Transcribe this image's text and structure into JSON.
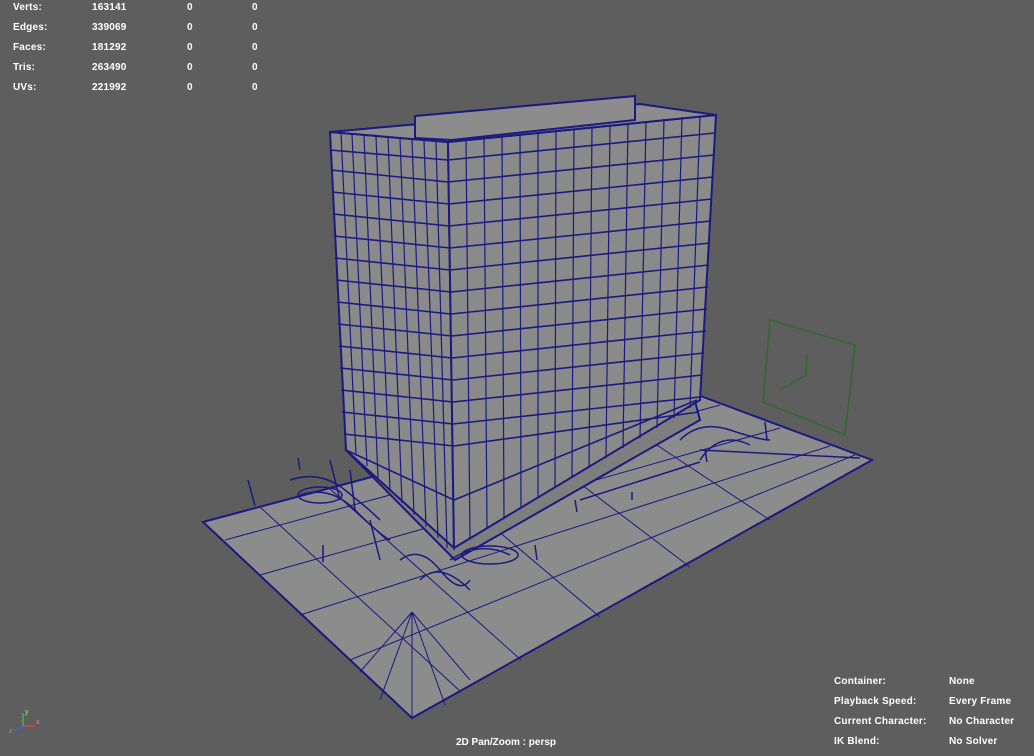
{
  "stats": [
    {
      "label": "Verts:",
      "v1": "163141",
      "v2": "0",
      "v3": "0"
    },
    {
      "label": "Edges:",
      "v1": "339069",
      "v2": "0",
      "v3": "0"
    },
    {
      "label": "Faces:",
      "v1": "181292",
      "v2": "0",
      "v3": "0"
    },
    {
      "label": "Tris:",
      "v1": "263490",
      "v2": "0",
      "v3": "0"
    },
    {
      "label": "UVs:",
      "v1": "221992",
      "v2": "0",
      "v3": "0"
    }
  ],
  "camera_label": "2D Pan/Zoom : persp",
  "info": [
    {
      "key": "Container:",
      "value": "None"
    },
    {
      "key": "Playback Speed:",
      "value": "Every Frame"
    },
    {
      "key": "Current Character:",
      "value": "No Character"
    },
    {
      "key": "IK Blend:",
      "value": "No Solver"
    }
  ],
  "axis_labels": {
    "x": "x",
    "y": "y",
    "z": "z"
  },
  "colors": {
    "background": "#5e5e5e",
    "wireframe": "#1a1a80",
    "surface": "#8c8c8c",
    "selection": "#2e6b2e"
  }
}
